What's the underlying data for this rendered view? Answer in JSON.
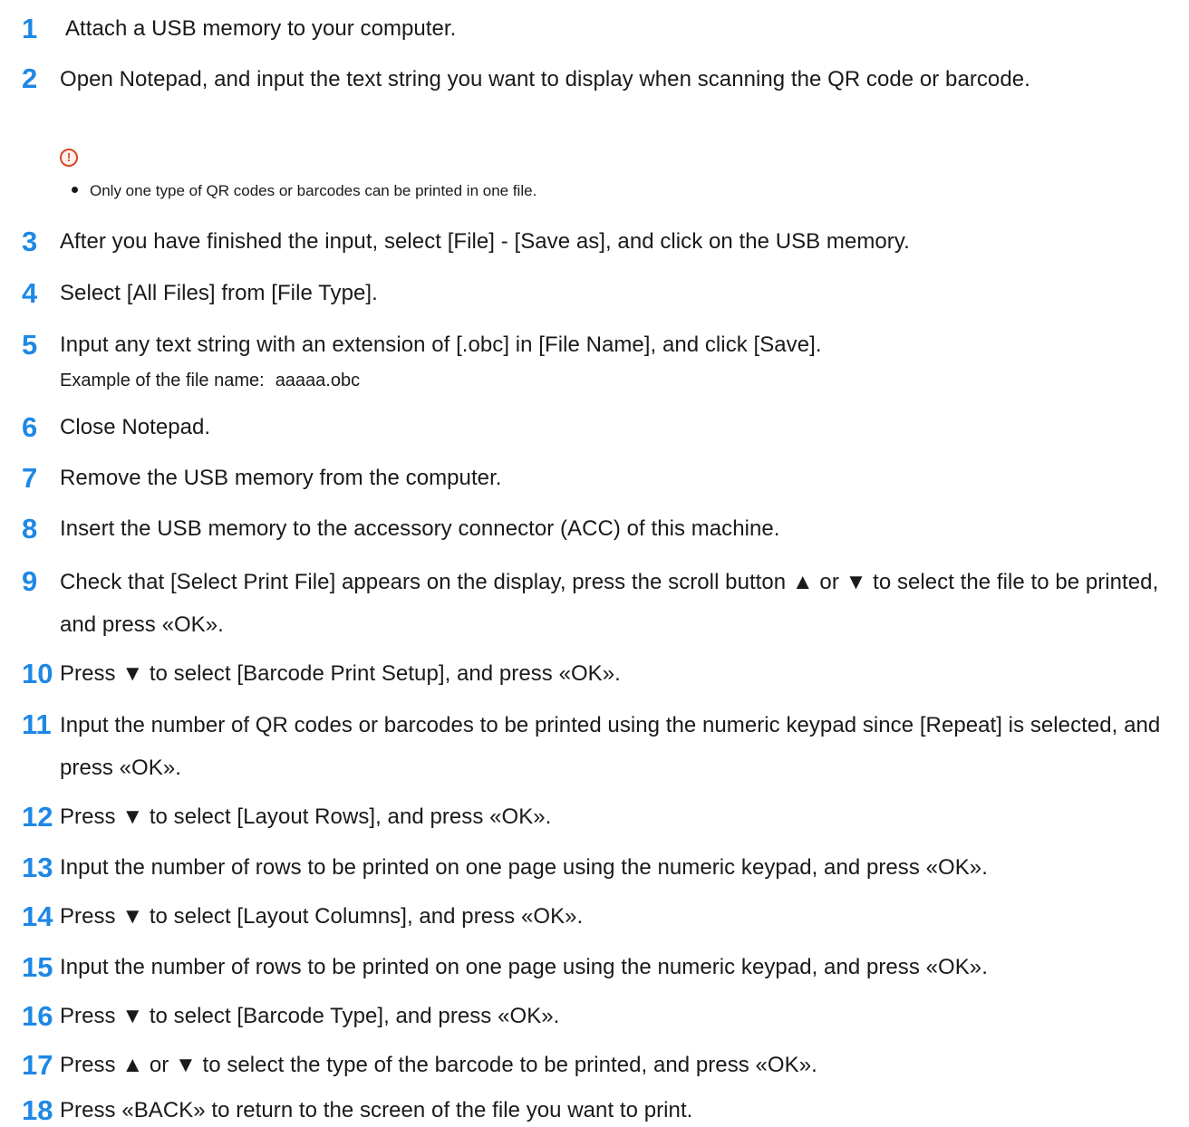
{
  "steps": [
    {
      "num": "1",
      "text": "Attach a USB memory to your computer."
    },
    {
      "num": "2",
      "text": "Open Notepad, and input the text string you want to display when scanning the QR code or barcode."
    },
    {
      "num": "3",
      "text": "After you have finished the input, select [File] - [Save as], and click on the USB memory."
    },
    {
      "num": "4",
      "text": "Select [All Files] from [File Type]."
    },
    {
      "num": "5",
      "text": "Input any text string with an extension of [.obc] in [File Name], and click [Save]."
    },
    {
      "num": "6",
      "text": "Close Notepad."
    },
    {
      "num": "7",
      "text": "Remove the USB memory from the computer."
    },
    {
      "num": "8",
      "text": "Insert the USB memory to the accessory connector (ACC) of this machine."
    },
    {
      "num": "9",
      "text": "Check that [Select Print File] appears on the display, press the scroll button ▲ or ▼ to select the file to be printed, and press «OK»."
    },
    {
      "num": "10",
      "text": "Press ▼ to select [Barcode Print Setup], and press «OK»."
    },
    {
      "num": "11",
      "text": "Input the number of QR codes or barcodes to be printed using the numeric keypad since [Repeat] is selected, and press «OK»."
    },
    {
      "num": "12",
      "text": "Press ▼ to select [Layout Rows], and press «OK»."
    },
    {
      "num": "13",
      "text": "Input the number of rows to be printed on one page using the numeric keypad, and press «OK»."
    },
    {
      "num": "14",
      "text": "Press ▼ to select [Layout Columns], and press «OK»."
    },
    {
      "num": "15",
      "text": "Input the number of rows to be printed on one page using the numeric keypad, and press «OK»."
    },
    {
      "num": "16",
      "text": "Press ▼ to select [Barcode Type], and press «OK»."
    },
    {
      "num": "17",
      "text": "Press ▲ or ▼ to select the type of the barcode to be printed, and press «OK»."
    },
    {
      "num": "18",
      "text": "Press «BACK» to return to the screen of the file you want to print."
    }
  ],
  "note": {
    "icon": "caution-icon",
    "icon_glyph": "!",
    "text": "Only one type of QR codes or barcodes can be printed in one file."
  },
  "example": {
    "label": "Example of the file name:",
    "value": "aaaaa.obc"
  },
  "colors": {
    "step_number": "#1e88e5",
    "caution": "#d9462b"
  }
}
